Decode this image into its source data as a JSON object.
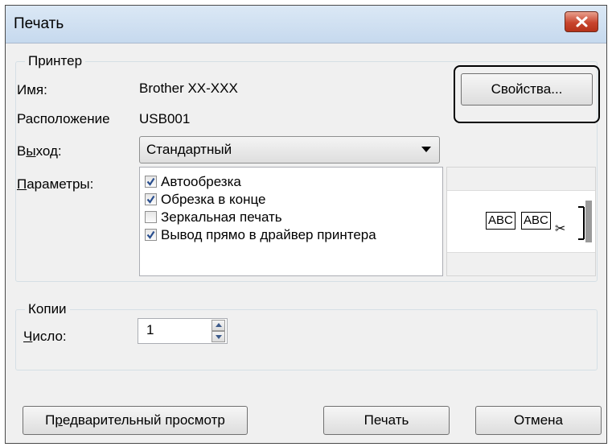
{
  "window": {
    "title": "Печать"
  },
  "printer_group": {
    "label": "Принтер",
    "name_label": "Имя:",
    "name_value": "Brother XX-XXX",
    "location_label": "Расположение",
    "location_value": "USB001",
    "properties_button": "Свойства...",
    "output_label_ul": "ы",
    "output_label_pre": "В",
    "output_label_post": "ход:",
    "output_value": "Стандартный",
    "params_label_ul": "П",
    "params_label_post": "араметры:",
    "options": [
      {
        "label": "Автообрезка",
        "checked": true
      },
      {
        "label": "Обрезка в конце",
        "checked": true
      },
      {
        "label": "Зеркальная печать",
        "checked": false
      },
      {
        "label": "Вывод прямо в драйвер принтера",
        "checked": true
      }
    ],
    "preview_labels": [
      "ABC",
      "ABC"
    ]
  },
  "copies_group": {
    "label": "Копии",
    "count_label_ul": "Ч",
    "count_label_post": "исло:",
    "count_value": "1"
  },
  "buttons": {
    "preview_ul": "р",
    "preview_pre": "П",
    "preview_post": "едварительный просмотр",
    "print": "Печать",
    "cancel": "Отмена"
  }
}
